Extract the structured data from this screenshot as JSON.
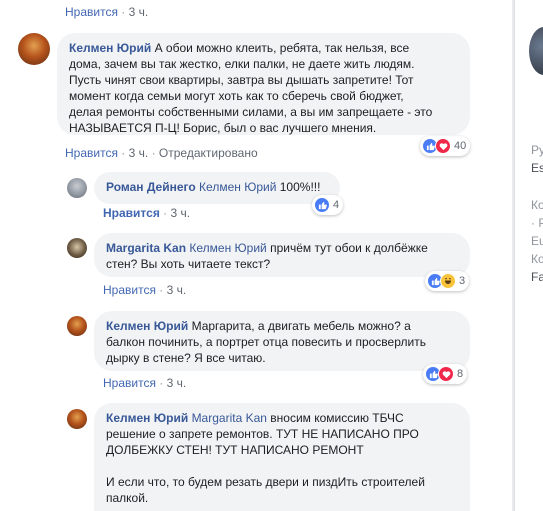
{
  "top_actions": {
    "like": "Нравится",
    "time": "3 ч."
  },
  "comment_main": {
    "author": "Келмен Юрий",
    "lines": [
      "А обои можно клеить, ребята, так нельзя, все",
      "дома, зачем вы так жестко, елки палки, не даете жить людям.",
      "Пусть чинят свои квартиры, завтра вы дышать запретите! Тот",
      "момент когда семьи могут хоть как то сберечь свой бюджет,",
      "делая ремонты собственными силами, а вы им запрещаете - это",
      "НАЗЫВАЕТСЯ П-Ц! Борис, был о вас лучшего мнения."
    ],
    "like": "Нравится",
    "time": "3 ч.",
    "edited": "Отредактировано",
    "reactions": {
      "icons": [
        "like-icon",
        "love-icon"
      ],
      "count": "40"
    }
  },
  "replies": [
    {
      "author": "Роман Дейнего",
      "mention": "Келмен Юрий",
      "lines": [
        "100%!!!"
      ],
      "like": "Нравится",
      "time": "3 ч.",
      "reactions": {
        "icons": [
          "like-icon"
        ],
        "count": "4"
      }
    },
    {
      "author": "Margarita Kan",
      "mention": "Келмен Юрий",
      "lines": [
        "причём тут обои к долбёжке",
        "стен? Вы хоть читаете текст?"
      ],
      "like": "Нравится",
      "time": "3 ч.",
      "reactions": {
        "icons": [
          "like-icon",
          "haha-icon"
        ],
        "count": "3"
      }
    },
    {
      "author": "Келмен Юрий",
      "mention": "",
      "lines": [
        "Маргарита, а двигать мебель можно? а",
        "балкон починить, а портрет отца повесить и просверлить",
        "дырку в стене? Я все читаю."
      ],
      "like": "Нравится",
      "time": "3 ч.",
      "reactions": {
        "icons": [
          "like-icon",
          "love-icon"
        ],
        "count": "8"
      }
    },
    {
      "author": "Келмен Юрий",
      "mention": "Margarita Kan",
      "lines": [
        "вносим комиссию ТБЧС",
        "решение о запрете ремонтов. ТУТ НЕ НАПИСАНО ПРО",
        "ДОЛБЕЖКУ СТЕН! ТУТ НАПИСАНО РЕМОНТ",
        "",
        "И если что, то будем резать двери и пиздИть строителей",
        "палкой."
      ]
    }
  ],
  "sidebar": {
    "lines": [
      "Ру",
      "Es",
      "Ко",
      "· Р",
      "Eu",
      "Ко",
      "Fa"
    ]
  },
  "colors": {
    "link": "#385898",
    "like": "#4267b2",
    "bubble": "#f2f3f5",
    "react_like": "#4a7cf5",
    "react_love": "#f0284a",
    "react_haha": "#f7c43c"
  }
}
